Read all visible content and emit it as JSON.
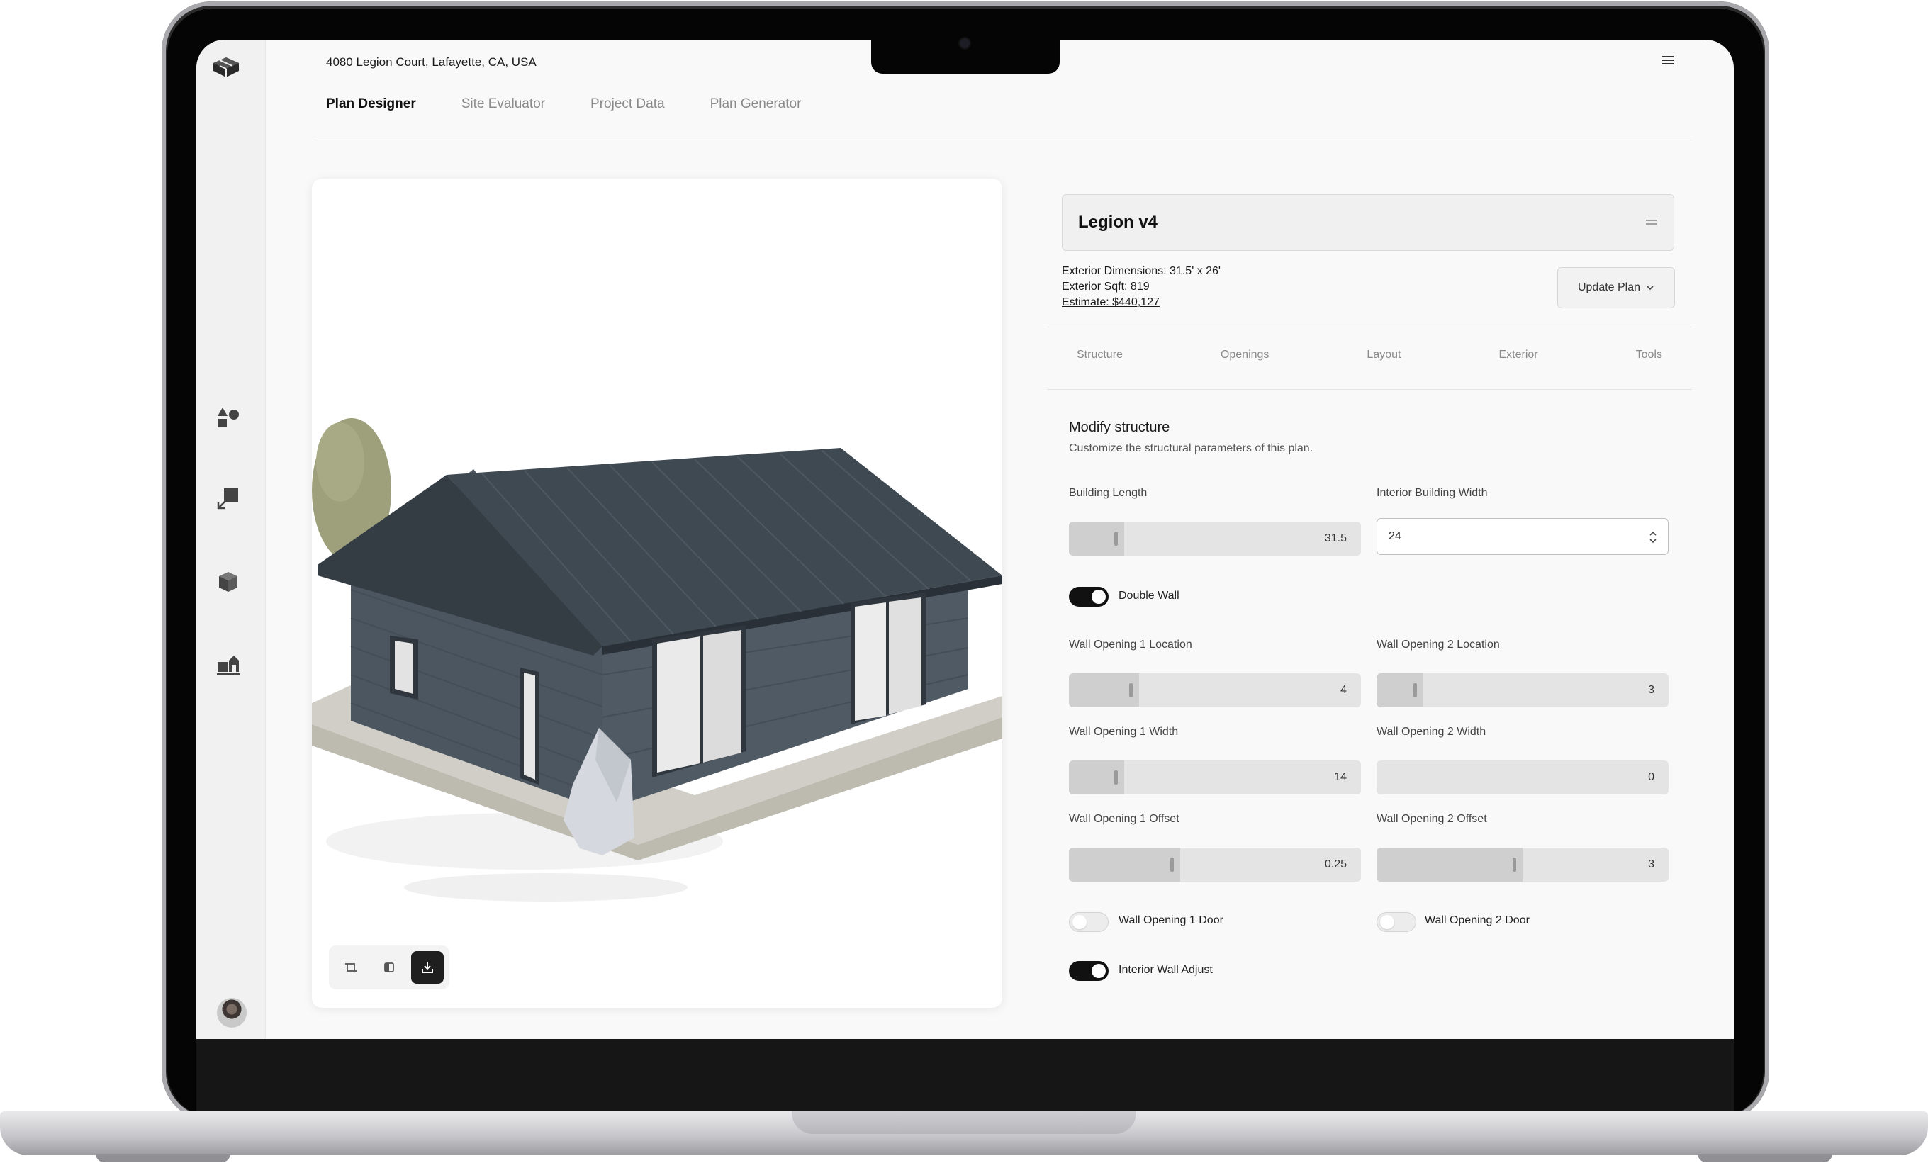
{
  "header": {
    "address": "4080 Legion Court, Lafayette, CA, USA"
  },
  "tabs": [
    {
      "label": "Plan Designer",
      "active": true
    },
    {
      "label": "Site Evaluator",
      "active": false
    },
    {
      "label": "Project Data",
      "active": false
    },
    {
      "label": "Plan Generator",
      "active": false
    }
  ],
  "sidebar": {
    "icons": [
      "logo-icon",
      "shapes-icon",
      "resize-icon",
      "cube-icon",
      "buildings-icon"
    ]
  },
  "plan": {
    "name": "Legion v4",
    "exterior_dimensions": "Exterior Dimensions: 31.5' x 26'",
    "exterior_sqft": "Exterior Sqft: 819",
    "estimate": "Estimate: $440,127",
    "update_label": "Update Plan"
  },
  "subtabs": [
    "Structure",
    "Openings",
    "Layout",
    "Exterior",
    "Tools"
  ],
  "structure": {
    "title": "Modify structure",
    "subtitle": "Customize the structural parameters of this plan.",
    "building_length": {
      "label": "Building Length",
      "value": "31.5",
      "fill_fraction": 0.19
    },
    "interior_width": {
      "label": "Interior Building Width",
      "value": "24"
    },
    "double_wall": {
      "label": "Double Wall",
      "on": true
    },
    "opening1_location": {
      "label": "Wall Opening 1 Location",
      "value": "4",
      "fill_fraction": 0.24
    },
    "opening2_location": {
      "label": "Wall Opening 2 Location",
      "value": "3",
      "fill_fraction": 0.16
    },
    "opening1_width": {
      "label": "Wall Opening 1 Width",
      "value": "14",
      "fill_fraction": 0.19
    },
    "opening2_width": {
      "label": "Wall Opening 2 Width",
      "value": "0",
      "fill_fraction": 0.0
    },
    "opening1_offset": {
      "label": "Wall Opening 1 Offset",
      "value": "0.25",
      "fill_fraction": 0.38
    },
    "opening2_offset": {
      "label": "Wall Opening 2 Offset",
      "value": "3",
      "fill_fraction": 0.5
    },
    "opening1_door": {
      "label": "Wall Opening 1 Door",
      "on": false
    },
    "opening2_door": {
      "label": "Wall Opening 2 Door",
      "on": false
    },
    "interior_wall_adjust": {
      "label": "Interior Wall Adjust",
      "on": true
    }
  },
  "viewer_tools": [
    "frame-icon",
    "split-view-icon",
    "download-icon"
  ]
}
